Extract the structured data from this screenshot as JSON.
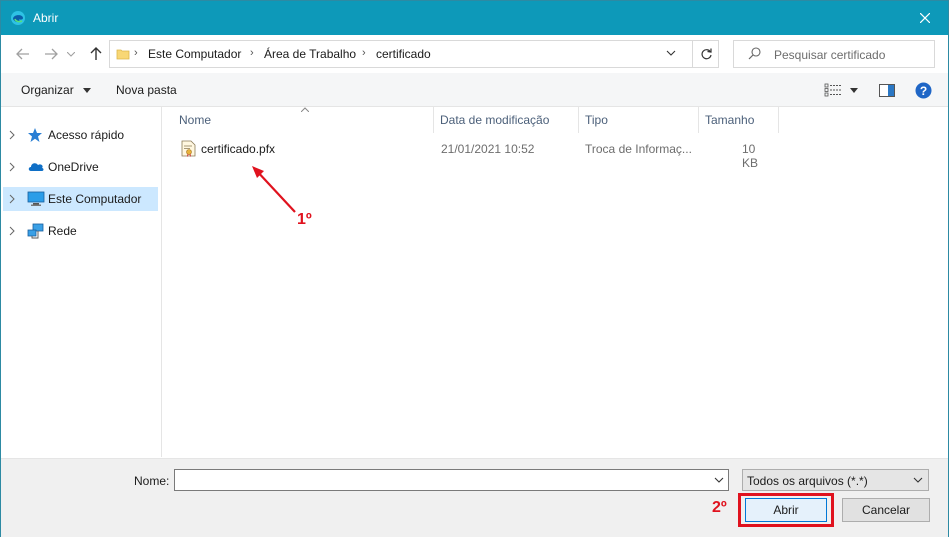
{
  "window": {
    "title": "Abrir"
  },
  "address": {
    "breadcrumbs": [
      "Este Computador",
      "Área de Trabalho",
      "certificado"
    ]
  },
  "search": {
    "placeholder": "Pesquisar certificado"
  },
  "toolbar": {
    "organize_label": "Organizar",
    "new_folder_label": "Nova pasta"
  },
  "sidebar": {
    "items": [
      {
        "label": "Acesso rápido",
        "icon": "star-icon"
      },
      {
        "label": "OneDrive",
        "icon": "cloud-icon"
      },
      {
        "label": "Este Computador",
        "icon": "computer-icon",
        "selected": true
      },
      {
        "label": "Rede",
        "icon": "network-icon"
      }
    ]
  },
  "filelist": {
    "columns": [
      "Nome",
      "Data de modificação",
      "Tipo",
      "Tamanho"
    ],
    "rows": [
      {
        "name": "certificado.pfx",
        "modified": "21/01/2021 10:52",
        "type": "Troca de Informaç...",
        "size": "10 KB",
        "icon": "certificate-file-icon"
      }
    ]
  },
  "footer": {
    "name_label": "Nome:",
    "name_value": "",
    "file_type": "Todos os arquivos (*.*)",
    "open_label": "Abrir",
    "cancel_label": "Cancelar"
  },
  "annotations": {
    "step1": "1º",
    "step2": "2º",
    "color": "#e0121e"
  },
  "colors": {
    "titlebar": "#0d99b9",
    "selection": "#cce8ff",
    "highlight": "#e0121e"
  }
}
